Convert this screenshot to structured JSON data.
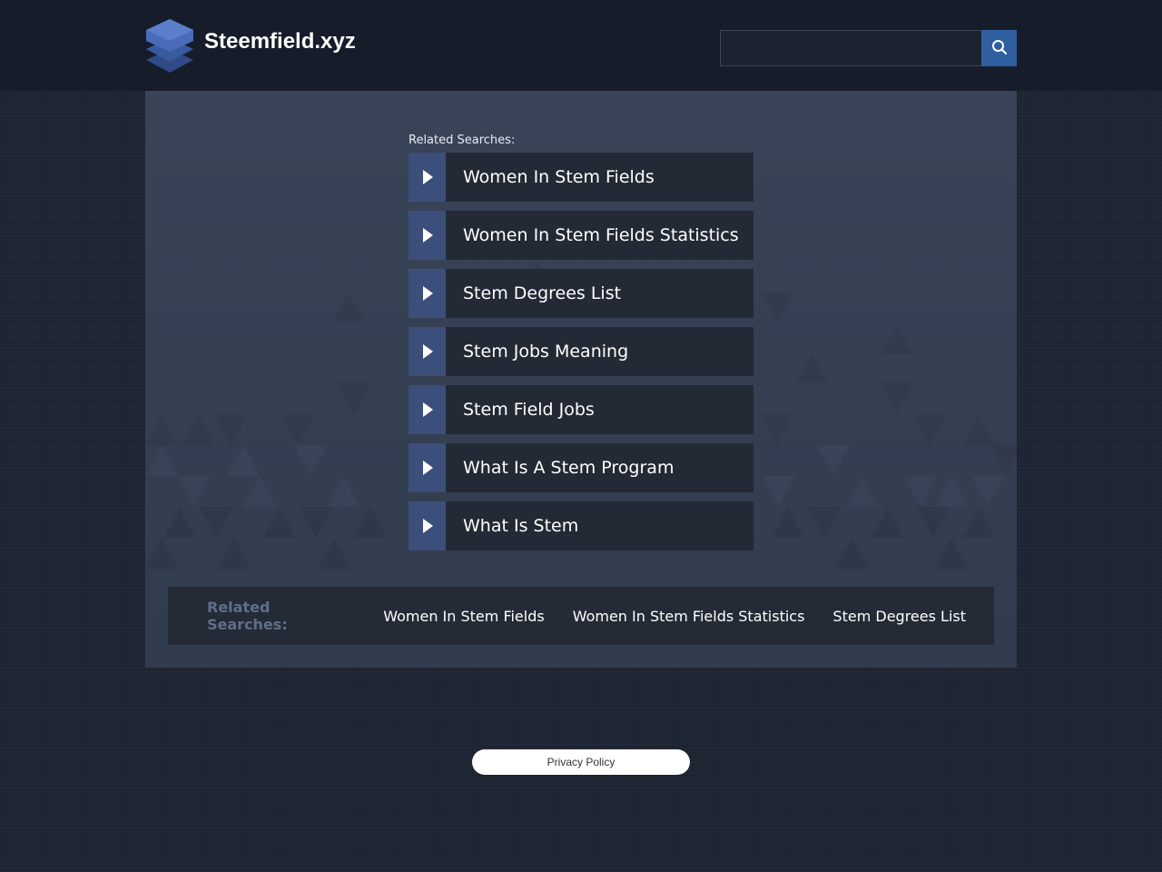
{
  "header": {
    "site_name": "Steemfield.xyz",
    "logo_icon": "stacked-layers-icon",
    "search": {
      "placeholder": "",
      "value": "",
      "button_icon": "search-icon"
    }
  },
  "main": {
    "related_label": "Related Searches:",
    "links": [
      {
        "label": "Women In Stem Fields",
        "icon": "play-arrow-icon"
      },
      {
        "label": "Women In Stem Fields Statistics",
        "icon": "play-arrow-icon"
      },
      {
        "label": "Stem Degrees List",
        "icon": "play-arrow-icon"
      },
      {
        "label": "Stem Jobs Meaning",
        "icon": "play-arrow-icon"
      },
      {
        "label": "Stem Field Jobs",
        "icon": "play-arrow-icon"
      },
      {
        "label": "What Is A Stem Program",
        "icon": "play-arrow-icon"
      },
      {
        "label": "What Is Stem",
        "icon": "play-arrow-icon"
      }
    ]
  },
  "bottom_bar": {
    "label": "Related Searches:",
    "links": [
      "Women In Stem Fields",
      "Women In Stem Fields Statistics",
      "Stem Degrees List"
    ]
  },
  "footer": {
    "privacy_label": "Privacy Policy"
  },
  "colors": {
    "header_bg": "#161c29",
    "panel_bg": "#3a4458",
    "arrow_bg": "#3c4f7a",
    "link_bg": "#232a36",
    "search_button": "#2f5fa0",
    "bottom_label": "#5f6f89"
  }
}
